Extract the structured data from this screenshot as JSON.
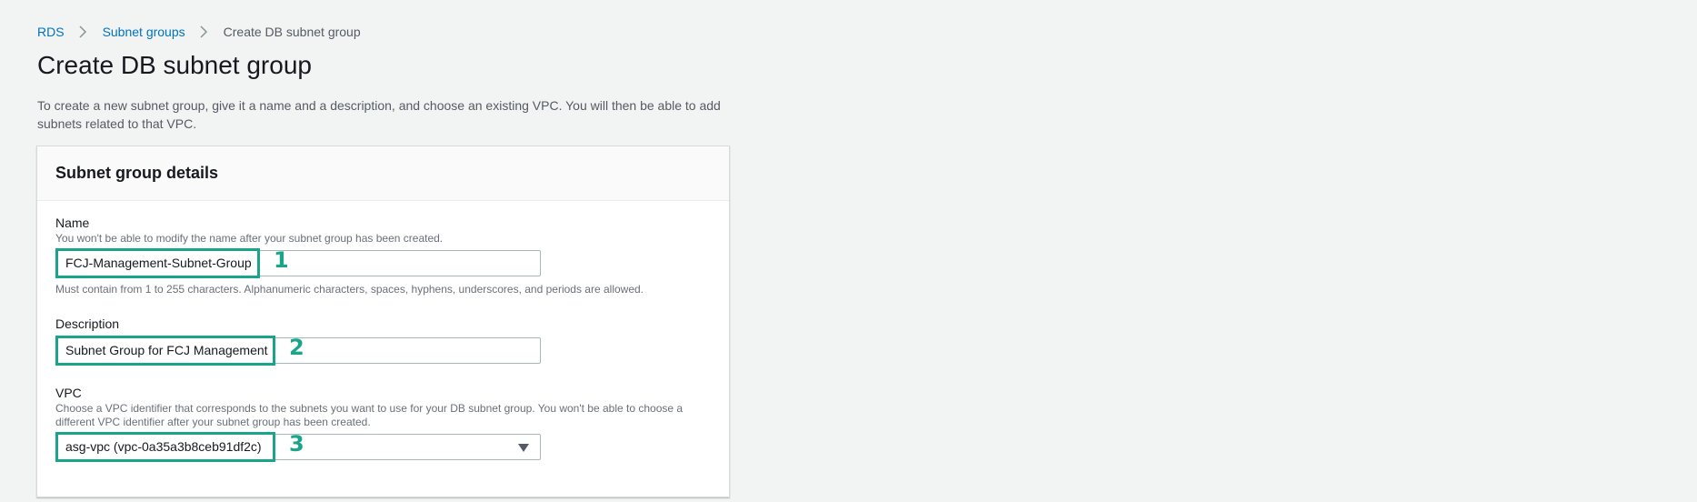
{
  "breadcrumb": {
    "items": [
      "RDS",
      "Subnet groups"
    ],
    "current": "Create DB subnet group"
  },
  "page": {
    "title": "Create DB subnet group",
    "intro": "To create a new subnet group, give it a name and a description, and choose an existing VPC. You will then be able to add subnets related to that VPC."
  },
  "panel": {
    "title": "Subnet group details",
    "name": {
      "label": "Name",
      "description": "You won't be able to modify the name after your subnet group has been created.",
      "value": "FCJ-Management-Subnet-Group",
      "constraint": "Must contain from 1 to 255 characters. Alphanumeric characters, spaces, hyphens, underscores, and periods are allowed.",
      "marker": "1"
    },
    "description": {
      "label": "Description",
      "value": "Subnet Group for FCJ Management",
      "marker": "2"
    },
    "vpc": {
      "label": "VPC",
      "description": "Choose a VPC identifier that corresponds to the subnets you want to use for your DB subnet group. You won't be able to choose a different VPC identifier after your subnet group has been created.",
      "selected": "asg-vpc (vpc-0a35a3b8ceb91df2c)",
      "marker": "3"
    }
  },
  "colors": {
    "link": "#0073bb",
    "highlight": "#1aa58b",
    "background": "#f2f3f3"
  },
  "icons": [
    "chevron-right-icon",
    "caret-down-icon"
  ]
}
